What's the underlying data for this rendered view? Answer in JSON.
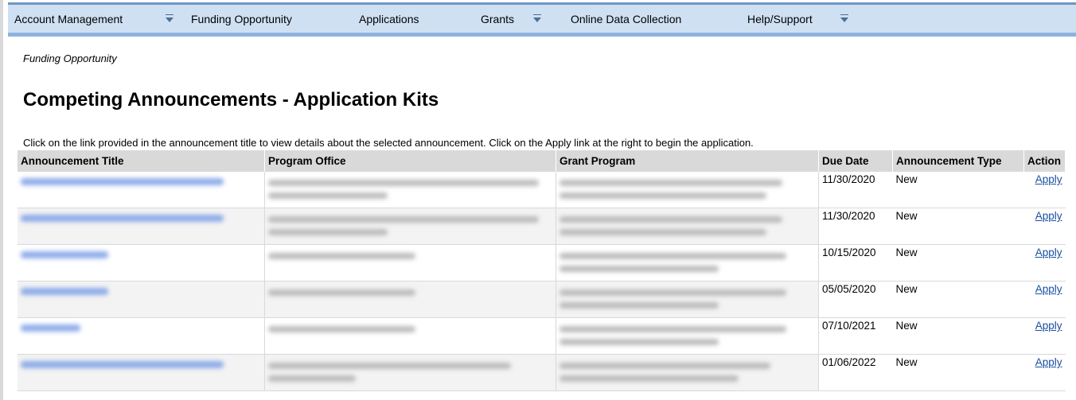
{
  "nav": {
    "items": [
      {
        "label": "Account Management",
        "has_menu": true
      },
      {
        "label": "Funding Opportunity",
        "has_menu": false
      },
      {
        "label": "Applications",
        "has_menu": false
      },
      {
        "label": "Grants",
        "has_menu": true
      },
      {
        "label": "Online Data Collection",
        "has_menu": false
      },
      {
        "label": "Help/Support",
        "has_menu": true
      }
    ]
  },
  "breadcrumb": "Funding Opportunity",
  "page_title": "Competing Announcements - Application Kits",
  "instructions": "Click on the link provided in the announcement title to view details about the selected announcement. Click on the Apply link at the right to begin the application.",
  "table": {
    "headers": [
      "Announcement Title",
      "Program Office",
      "Grant Program",
      "Due Date",
      "Announcement Type",
      "Action"
    ],
    "rows": [
      {
        "due_date": "11/30/2020",
        "type": "New",
        "action": "Apply"
      },
      {
        "due_date": "11/30/2020",
        "type": "New",
        "action": "Apply"
      },
      {
        "due_date": "10/15/2020",
        "type": "New",
        "action": "Apply"
      },
      {
        "due_date": "05/05/2020",
        "type": "New",
        "action": "Apply"
      },
      {
        "due_date": "07/10/2021",
        "type": "New",
        "action": "Apply"
      },
      {
        "due_date": "01/06/2022",
        "type": "New",
        "action": "Apply"
      }
    ]
  },
  "colors": {
    "nav_bg": "#cfe0f3",
    "link": "#1a4fa0",
    "header_bg": "#d9d9d9"
  },
  "icons": {
    "menu": "chevron-down-icon"
  }
}
